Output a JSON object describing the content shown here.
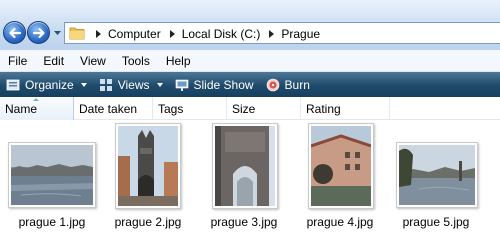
{
  "address": {
    "crumbs": [
      "Computer",
      "Local Disk (C:)",
      "Prague"
    ]
  },
  "menu": [
    "File",
    "Edit",
    "View",
    "Tools",
    "Help"
  ],
  "toolbar": {
    "organize": "Organize",
    "views": "Views",
    "slideshow": "Slide Show",
    "burn": "Burn"
  },
  "columns": [
    "Name",
    "Date taken",
    "Tags",
    "Size",
    "Rating"
  ],
  "files": [
    {
      "name": "prague 1.jpg"
    },
    {
      "name": "prague 2.jpg"
    },
    {
      "name": "prague 3.jpg"
    },
    {
      "name": "prague 4.jpg"
    },
    {
      "name": "prague 5.jpg"
    }
  ],
  "colors": {
    "toolbar": "#1f4a6b",
    "address_bar": "#c9dcf1",
    "nav_button": "#2a68c4"
  }
}
